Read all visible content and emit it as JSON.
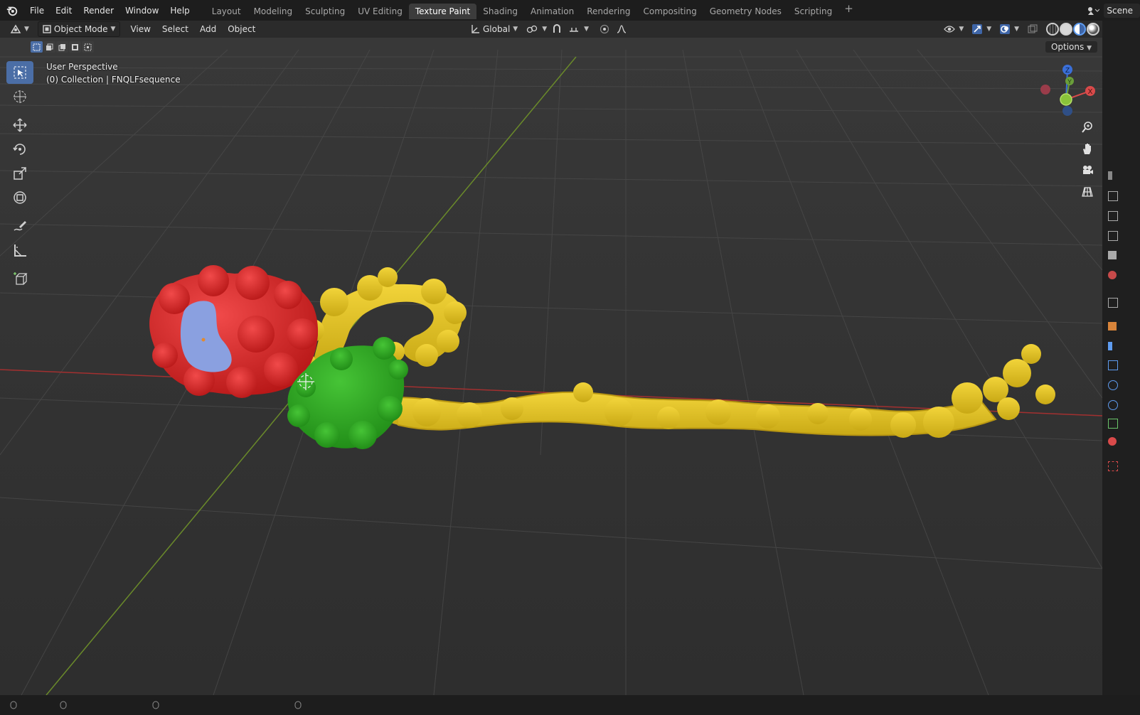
{
  "topbar": {
    "menus": [
      "File",
      "Edit",
      "Render",
      "Window",
      "Help"
    ],
    "workspaces": [
      "Layout",
      "Modeling",
      "Sculpting",
      "UV Editing",
      "Texture Paint",
      "Shading",
      "Animation",
      "Rendering",
      "Compositing",
      "Geometry Nodes",
      "Scripting"
    ],
    "active_workspace": "Texture Paint",
    "add_workspace": "+",
    "scene_label": "Scene"
  },
  "header": {
    "mode": "Object Mode",
    "menus": [
      "View",
      "Select",
      "Add",
      "Object"
    ],
    "transform_orientation": "Global",
    "options": "Options"
  },
  "viewport": {
    "perspective_label": "User Perspective",
    "collection_label": "(0) Collection | FNQLFsequence"
  },
  "gizmo": {
    "z_label": "Z",
    "y_label": "Y",
    "x_label": "X"
  },
  "colors": {
    "red_domain": "#e02a2a",
    "blue_patch": "#8aa0e0",
    "green_domain": "#2eae20",
    "yellow_chain": "#e3c526",
    "x_axis": "#a33030",
    "y_axis": "#6a8a2a",
    "accent": "#4b6ea6"
  },
  "icons": {
    "toolbar": [
      "select-box-icon",
      "cursor-icon",
      "move-icon",
      "rotate-icon",
      "scale-icon",
      "transform-icon",
      "annotate-icon",
      "measure-icon",
      "add-cube-icon"
    ],
    "nav": [
      "zoom-icon",
      "pan-hand-icon",
      "camera-icon",
      "ortho-grid-icon"
    ]
  }
}
